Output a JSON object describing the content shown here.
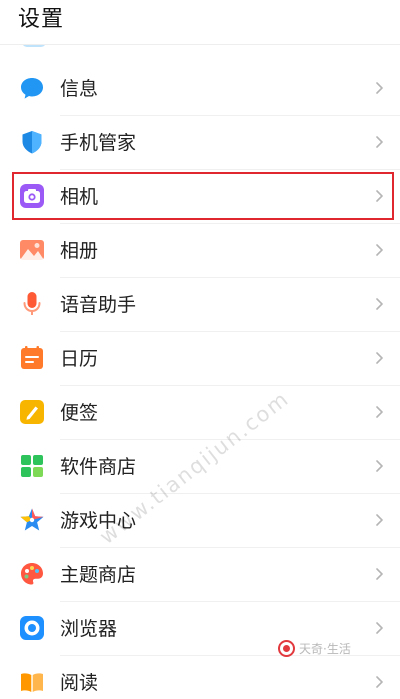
{
  "header": {
    "title": "设置"
  },
  "settings": {
    "items": [
      {
        "label": "信息",
        "icon": "message-bubble-icon",
        "color": "#2196f3"
      },
      {
        "label": "手机管家",
        "icon": "shield-icon",
        "color": "#1e88e5"
      },
      {
        "label": "相机",
        "icon": "camera-icon",
        "color": "#9b59f6",
        "highlighted": true
      },
      {
        "label": "相册",
        "icon": "gallery-icon",
        "color": "#ff6b5a"
      },
      {
        "label": "语音助手",
        "icon": "microphone-icon",
        "color": "#ff5a36"
      },
      {
        "label": "日历",
        "icon": "calendar-icon",
        "color": "#ff7a2a"
      },
      {
        "label": "便签",
        "icon": "notes-icon",
        "color": "#f7b500"
      },
      {
        "label": "软件商店",
        "icon": "app-store-icon",
        "color": "#2ec45b"
      },
      {
        "label": "游戏中心",
        "icon": "game-star-icon",
        "color": "#2a8cf0"
      },
      {
        "label": "主题商店",
        "icon": "palette-icon",
        "color": "#ff5740"
      },
      {
        "label": "浏览器",
        "icon": "browser-icon",
        "color": "#1e90ff"
      },
      {
        "label": "阅读",
        "icon": "book-icon",
        "color": "#ff9800"
      }
    ]
  },
  "highlight": {
    "color": "#e0262f"
  },
  "watermark": {
    "text": "www.tianqijun.com"
  },
  "brand": {
    "text": "天奇·生活"
  }
}
